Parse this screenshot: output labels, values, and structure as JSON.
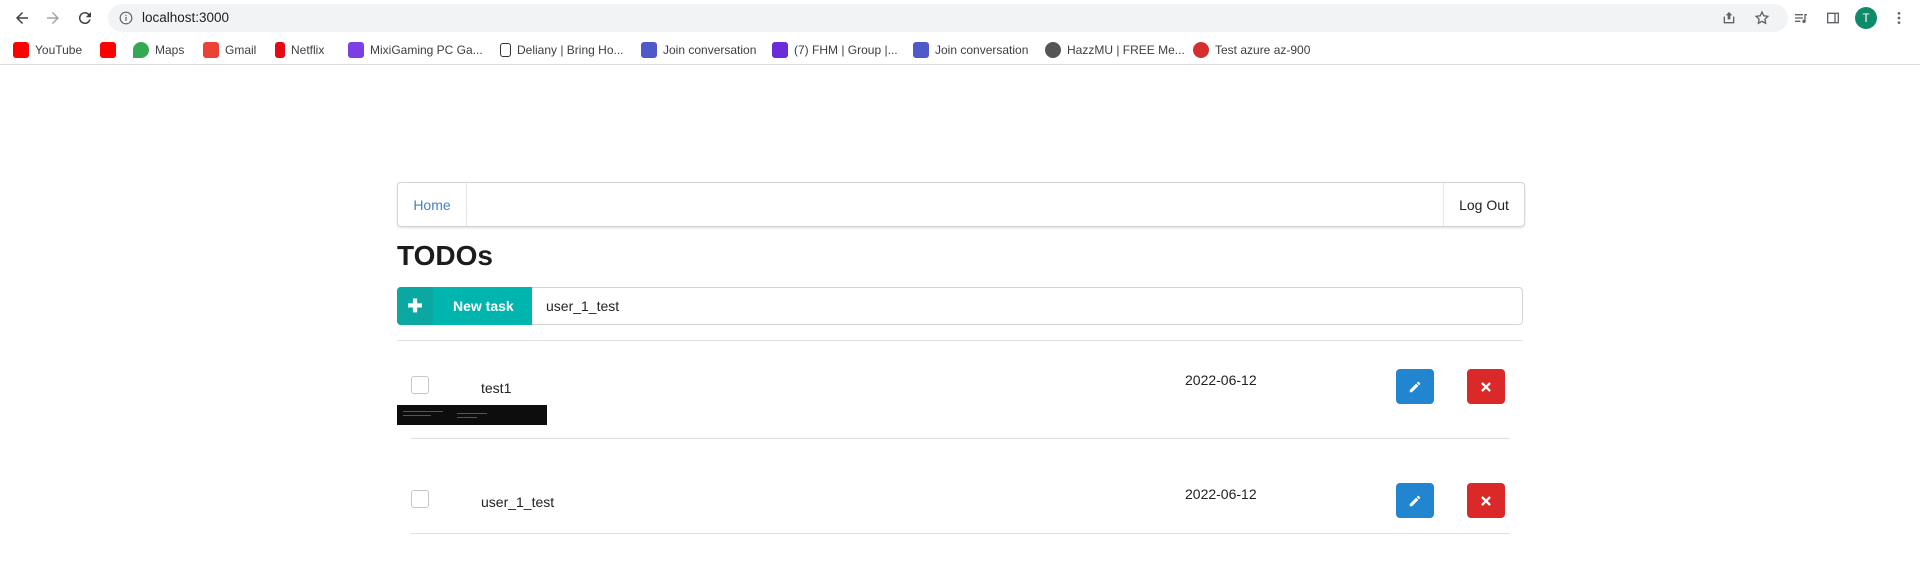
{
  "browser": {
    "url": "localhost:3000",
    "avatar_initial": "T",
    "bookmarks": [
      {
        "label": "YouTube",
        "icon": "youtube-icon",
        "color": "#ff0000"
      },
      {
        "label": "",
        "icon": "youtube-icon",
        "color": "#ff0000"
      },
      {
        "label": "Maps",
        "icon": "maps-icon",
        "color": "#34a853"
      },
      {
        "label": "Gmail",
        "icon": "gmail-icon",
        "color": "#ea4335"
      },
      {
        "label": "Netflix",
        "icon": "netflix-icon",
        "color": "#e50914"
      },
      {
        "label": "MixiGaming PC Ga...",
        "icon": "mixigaming-icon",
        "color": "#7b3fe4"
      },
      {
        "label": "Deliany | Bring Ho...",
        "icon": "shopping-bag-icon",
        "color": "#333333"
      },
      {
        "label": "Join conversation",
        "icon": "teams-icon",
        "color": "#5059c9"
      },
      {
        "label": "(7) FHM | Group |...",
        "icon": "fhm-icon",
        "color": "#6c2bd9"
      },
      {
        "label": "Join conversation",
        "icon": "teams-icon",
        "color": "#5059c9"
      },
      {
        "label": "HazzMU | FREE Me...",
        "icon": "globe-icon",
        "color": "#555555"
      },
      {
        "label": "Test azure az-900",
        "icon": "quiz-icon",
        "color": "#d32f2f"
      }
    ]
  },
  "nav": {
    "home_label": "Home",
    "logout_label": "Log Out"
  },
  "page_title": "TODOs",
  "new_task": {
    "button_label": "New task",
    "input_value": "user_1_test"
  },
  "todos": [
    {
      "name": "test1",
      "date": "2022-06-12",
      "checked": false
    },
    {
      "name": "user_1_test",
      "date": "2022-06-12",
      "checked": false
    }
  ],
  "colors": {
    "accent_teal": "#00b5ad",
    "edit_blue": "#2185d0",
    "delete_red": "#db2828",
    "link_blue": "#4183c4"
  }
}
